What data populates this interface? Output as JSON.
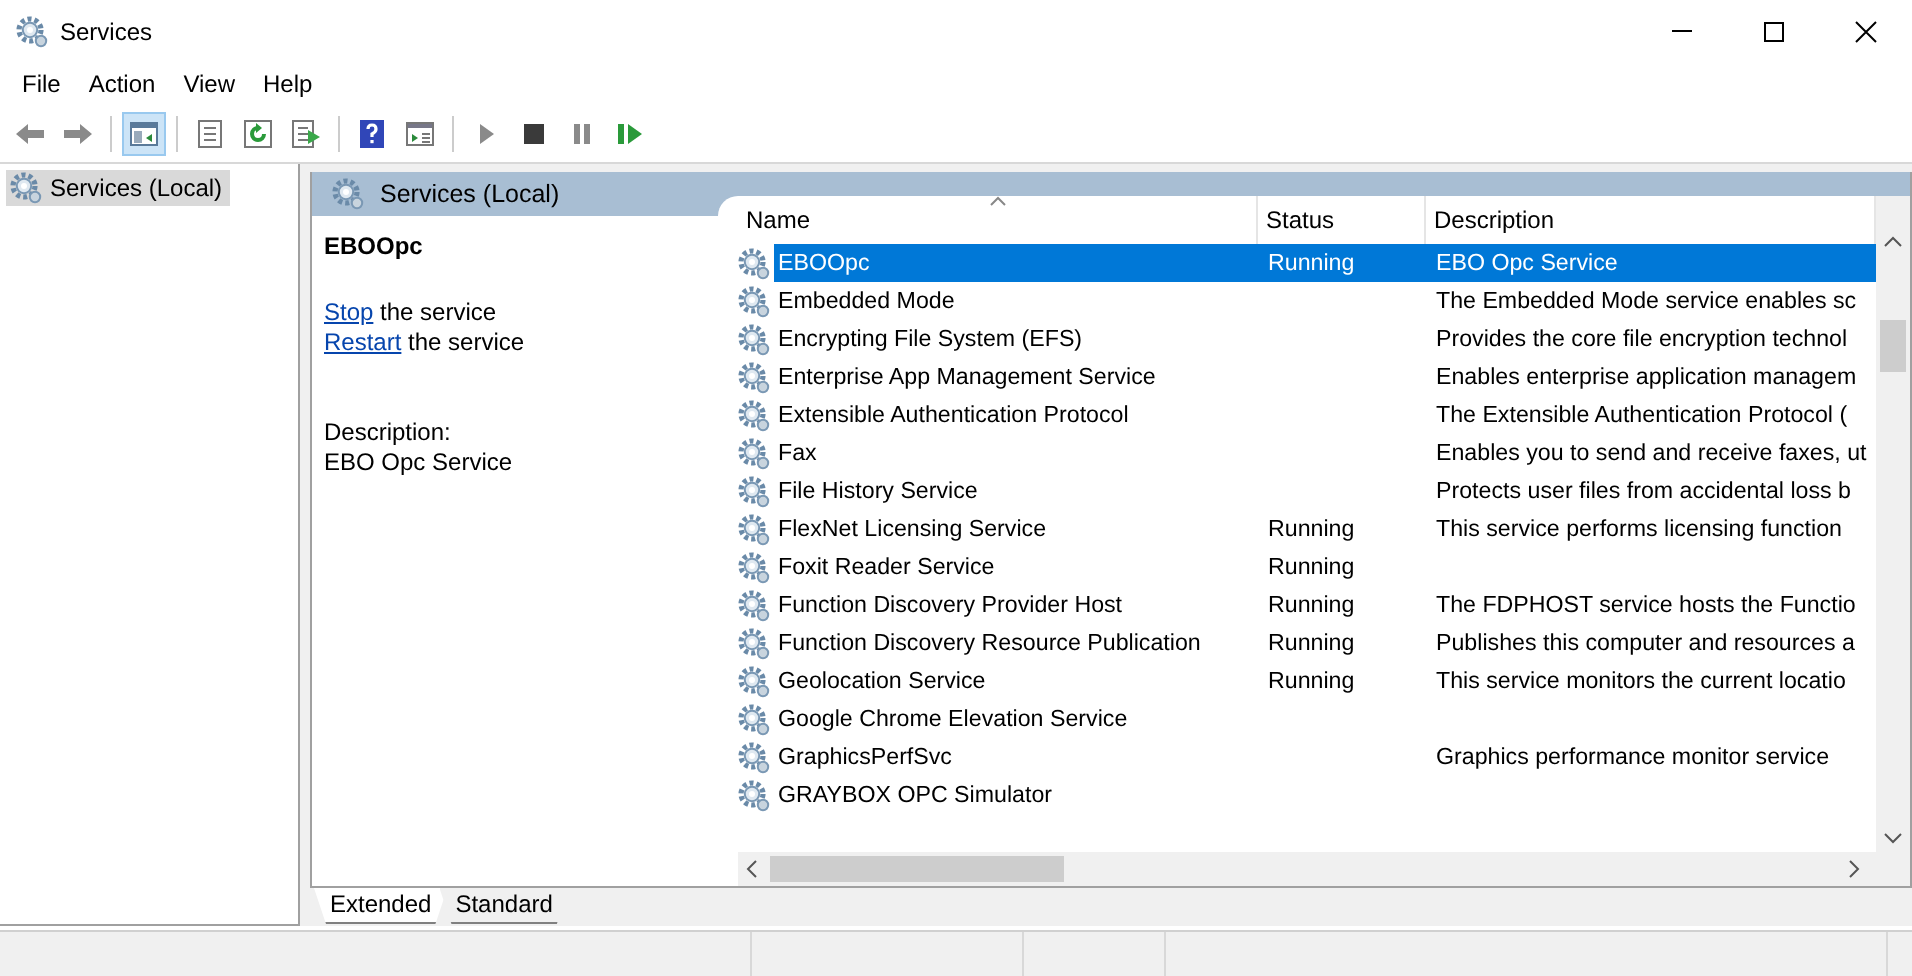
{
  "window": {
    "title": "Services"
  },
  "menu": [
    "File",
    "Action",
    "View",
    "Help"
  ],
  "toolbar": [
    {
      "kind": "back",
      "pressed": false
    },
    {
      "kind": "forward",
      "pressed": false
    },
    {
      "kind": "tree",
      "pressed": true
    },
    {
      "kind": "properties",
      "pressed": false
    },
    {
      "kind": "refresh",
      "pressed": false
    },
    {
      "kind": "export",
      "pressed": false
    },
    {
      "kind": "help",
      "pressed": false
    },
    {
      "kind": "console",
      "pressed": false
    },
    {
      "kind": "start",
      "pressed": false
    },
    {
      "kind": "stop",
      "pressed": false
    },
    {
      "kind": "pause",
      "pressed": false
    },
    {
      "kind": "resume",
      "pressed": false
    }
  ],
  "tree": {
    "items": [
      {
        "label": "Services (Local)",
        "selected": true
      }
    ]
  },
  "pane": {
    "title": "Services (Local)"
  },
  "detail": {
    "service": "EBOOpc",
    "actions": [
      {
        "link": "Stop",
        "text": "the service"
      },
      {
        "link": "Restart",
        "text": "the service"
      }
    ],
    "description_label": "Description:",
    "description": "EBO Opc Service"
  },
  "table": {
    "columns": [
      "Name",
      "Status",
      "Description"
    ],
    "rows": [
      {
        "name": "EBOOpc",
        "status": "Running",
        "description": "EBO Opc Service",
        "selected": true
      },
      {
        "name": "Embedded Mode",
        "description": "The Embedded Mode service enables sc",
        "selected": false
      },
      {
        "name": "Encrypting File System (EFS)",
        "description": "Provides the core file encryption technol",
        "selected": false
      },
      {
        "name": "Enterprise App Management Service",
        "description": "Enables enterprise application managem",
        "selected": false
      },
      {
        "name": "Extensible Authentication Protocol",
        "description": "The Extensible Authentication Protocol (",
        "selected": false
      },
      {
        "name": "Fax",
        "description": "Enables you to send and receive faxes, ut",
        "selected": false
      },
      {
        "name": "File History Service",
        "description": "Protects user files from accidental loss b",
        "selected": false
      },
      {
        "name": "FlexNet Licensing Service",
        "status": "Running",
        "description": "This service performs licensing function",
        "selected": false
      },
      {
        "name": "Foxit Reader Service",
        "status": "Running",
        "selected": false
      },
      {
        "name": "Function Discovery Provider Host",
        "status": "Running",
        "description": "The FDPHOST service hosts the Functio",
        "selected": false
      },
      {
        "name": "Function Discovery Resource Publication",
        "status": "Running",
        "description": "Publishes this computer and resources a",
        "selected": false
      },
      {
        "name": "Geolocation Service",
        "status": "Running",
        "description": "This service monitors the current locatio",
        "selected": false
      },
      {
        "name": "Google Chrome Elevation Service",
        "selected": false
      },
      {
        "name": "GraphicsPerfSvc",
        "description": "Graphics performance monitor service",
        "selected": false
      },
      {
        "name": "GRAYBOX OPC Simulator",
        "selected": false
      }
    ]
  },
  "view_tabs": [
    {
      "label": "Extended",
      "selected": true
    },
    {
      "label": "Standard",
      "selected": false
    }
  ]
}
